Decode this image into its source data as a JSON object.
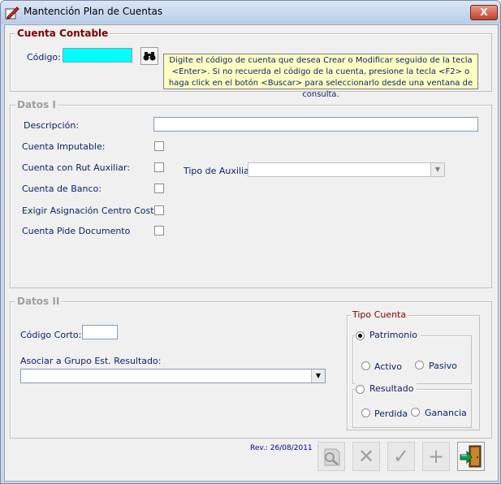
{
  "window": {
    "title": "Mantención Plan de Cuentas",
    "close_label": "X"
  },
  "cuenta_contable": {
    "legend": "Cuenta Contable",
    "codigo_label": "Código:",
    "codigo_value": "",
    "hint": "Digite el código de cuenta que desea Crear o Modificar seguido de la tecla <Enter>. Si no recuerda el código de la cuenta, presione la tecla <F2> o haga click en el botón <Buscar> para seleccionarlo desde una ventana de consulta."
  },
  "datos1": {
    "legend": "Datos I",
    "descripcion_label": "Descripción:",
    "descripcion_value": "",
    "imputable_label": "Cuenta Imputable:",
    "rut_auxiliar_label": "Cuenta con Rut Auxiliar:",
    "tipo_auxiliar_label": "Tipo de Auxiliar:",
    "tipo_auxiliar_value": "",
    "banco_label": "Cuenta de Banco:",
    "centro_costo_label": "Exigir Asignación Centro Costo:",
    "pide_documento_label": "Cuenta Pide Documento"
  },
  "datos2": {
    "legend": "Datos II",
    "codigo_corto_label": "Código Corto:",
    "codigo_corto_value": "",
    "grupo_label": "Asociar a Grupo Est. Resultado:",
    "grupo_value": ""
  },
  "tipo_cuenta": {
    "legend": "Tipo Cuenta",
    "patrimonio": "Patrimonio",
    "activo": "Activo",
    "pasivo": "Pasivo",
    "resultado": "Resultado",
    "perdida": "Perdida",
    "ganancia": "Ganancia",
    "selected": "Patrimonio"
  },
  "footer": {
    "revision": "Rev.: 26/08/2011"
  },
  "icons": [
    "binoculars-icon",
    "search-doc-icon",
    "delete-icon",
    "check-icon",
    "add-icon",
    "exit-door-icon"
  ],
  "colors": {
    "accent_red": "#800000",
    "label_blue": "#0a246a",
    "codigo_field": "#00ffff",
    "hint_bg": "#ffffc4"
  }
}
